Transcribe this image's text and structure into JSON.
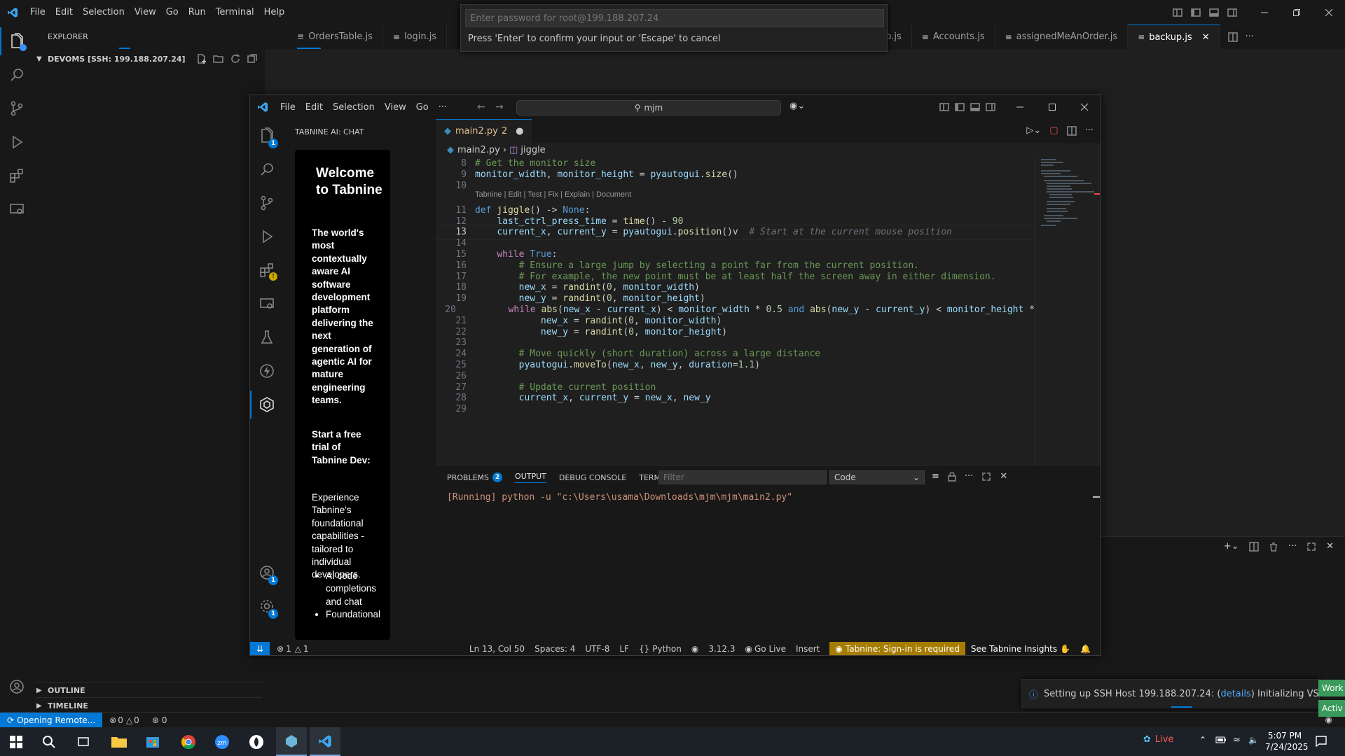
{
  "outer": {
    "menu": [
      "File",
      "Edit",
      "Selection",
      "View",
      "Go",
      "Run",
      "Terminal",
      "Help"
    ],
    "tabs": [
      {
        "label": "OrdersTable.js"
      },
      {
        "label": "login.js"
      },
      {
        "label": "generatePo.js"
      },
      {
        "label": "Accounts.js"
      },
      {
        "label": "assignedMeAnOrder.js"
      },
      {
        "label": "backup.js"
      }
    ],
    "explorer_title": "EXPLORER",
    "folder_label": "DEVOMS [SSH: 199.188.207.24]",
    "outline_label": "OUTLINE",
    "timeline_label": "TIMELINE",
    "remote_status": "Opening Remote...",
    "errors_status": "0",
    "warnings_status": "0",
    "ports_status": "0",
    "notification_text": "Setting up SSH Host 199.188.207.24: (",
    "notification_link": "details",
    "notification_rest": ") Initializing VS Code Se",
    "side_tags": [
      "Work",
      "Activ"
    ]
  },
  "quick_input": {
    "placeholder": "Enter password for root@199.188.207.24",
    "hint": "Press 'Enter' to confirm your input or 'Escape' to cancel"
  },
  "inner": {
    "menu": [
      "File",
      "Edit",
      "Selection",
      "View",
      "Go",
      "···"
    ],
    "search_text": "mjm",
    "sidebar_title": "TABNINE AI: CHAT",
    "tab_label": "main2.py",
    "tab_badge": "2",
    "breadcrumb_file": "main2.py",
    "breadcrumb_symbol": "jiggle",
    "codelens": "Tabnine | Edit | Test | Fix | Explain | Document",
    "panel_tabs": [
      "PROBLEMS",
      "OUTPUT",
      "DEBUG CONSOLE",
      "TERMINAL"
    ],
    "problems_count": "2",
    "panel_filter_placeholder": "Filter",
    "panel_dropdown": "Code",
    "output_line": "[Running] python -u \"c:\\Users\\usama\\Downloads\\mjm\\mjm\\main2.py\"",
    "activity_badges": {
      "explorer": "1",
      "account": "1",
      "settings": "1"
    }
  },
  "tabnine": {
    "heading": "Welcome to Tabnine",
    "intro": "The world's most contextually aware AI software development platform delivering the next generation of agentic AI for mature engineering teams.",
    "trial_heading": "Start a free trial of Tabnine Dev:",
    "trial_text": "Experience Tabnine's foundational capabilities - tailored to individual developers.",
    "bullets": [
      "AI code completions and chat",
      "Foundational"
    ]
  },
  "status": {
    "errors": "1",
    "warnings": "1",
    "position": "Ln 13, Col 50",
    "spaces": "Spaces: 4",
    "encoding": "UTF-8",
    "eol": "LF",
    "language": "Python",
    "version": "3.12.3",
    "go_live": "Go Live",
    "mode": "Insert",
    "tabnine": "Tabnine: Sign-in is required",
    "insights": "See Tabnine Insights"
  },
  "taskbar": {
    "live_label": "Live",
    "time": "5:07 PM",
    "date": "7/24/2025"
  },
  "code": [
    {
      "n": "8",
      "html": "<span class='cm'># Get the monitor size</span>"
    },
    {
      "n": "9",
      "html": "<span class='vr'>monitor_width</span>, <span class='vr'>monitor_height</span> = <span class='vr'>pyautogui</span>.<span class='fn'>size</span>()"
    },
    {
      "n": "10",
      "html": ""
    },
    {
      "n": "11",
      "html": "<span class='kw'>def</span> <span class='fn'>jiggle</span>() -&gt; <span class='kw'>None</span>:"
    },
    {
      "n": "12",
      "html": "    <span class='vr'>last_ctrl_press_time</span> = <span class='fn'>time</span>() - <span class='nm'>90</span>"
    },
    {
      "n": "13",
      "html": "    <span class='vr'>current_x</span>, <span class='vr'>current_y</span> = <span class='vr'>pyautogui</span>.<span class='fn'>position</span>()v  <span class='cm' style='font-style:italic;color:#6a737d'># Start at the current mouse position</span>"
    },
    {
      "n": "14",
      "html": ""
    },
    {
      "n": "15",
      "html": "    <span class='ctl'>while</span> <span class='kw'>True</span>:"
    },
    {
      "n": "16",
      "html": "        <span class='cm'># Ensure a large jump by selecting a point far from the current position.</span>"
    },
    {
      "n": "17",
      "html": "        <span class='cm'># For example, the new point must be at least half the screen away in either dimension.</span>"
    },
    {
      "n": "18",
      "html": "        <span class='vr'>new_x</span> = <span class='fn'>randint</span>(<span class='nm'>0</span>, <span class='vr'>monitor_width</span>)"
    },
    {
      "n": "19",
      "html": "        <span class='vr'>new_y</span> = <span class='fn'>randint</span>(<span class='nm'>0</span>, <span class='vr'>monitor_height</span>)"
    },
    {
      "n": "20",
      "html": "        <span class='ctl'>while</span> <span class='fn'>abs</span>(<span class='vr'>new_x</span> - <span class='vr'>current_x</span>) &lt; <span class='vr'>monitor_width</span> * <span class='nm'>0.5</span> <span class='kw'>and</span> <span class='fn'>abs</span>(<span class='vr'>new_y</span> - <span class='vr'>current_y</span>) &lt; <span class='vr'>monitor_height</span> *"
    },
    {
      "n": "21",
      "html": "            <span class='vr'>new_x</span> = <span class='fn'>randint</span>(<span class='nm'>0</span>, <span class='vr'>monitor_width</span>)"
    },
    {
      "n": "22",
      "html": "            <span class='vr'>new_y</span> = <span class='fn'>randint</span>(<span class='nm'>0</span>, <span class='vr'>monitor_height</span>)"
    },
    {
      "n": "23",
      "html": ""
    },
    {
      "n": "24",
      "html": "        <span class='cm'># Move quickly (short duration) across a large distance</span>"
    },
    {
      "n": "25",
      "html": "        <span class='vr'>pyautogui</span>.<span class='fn'>moveTo</span>(<span class='vr'>new_x</span>, <span class='vr'>new_y</span>, <span class='vr'>duration</span>=<span class='nm'>1.1</span>)"
    },
    {
      "n": "26",
      "html": ""
    },
    {
      "n": "27",
      "html": "        <span class='cm'># Update current position</span>"
    },
    {
      "n": "28",
      "html": "        <span class='vr'>current_x</span>, <span class='vr'>current_y</span> = <span class='vr'>new_x</span>, <span class='vr'>new_y</span>"
    },
    {
      "n": "29",
      "html": ""
    }
  ]
}
